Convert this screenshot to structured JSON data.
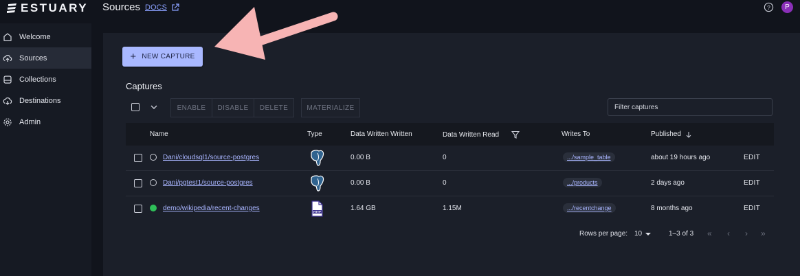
{
  "app": {
    "logo_text": "ESTUARY",
    "page_title": "Sources",
    "docs_label": "DOCS",
    "avatar_letter": "P"
  },
  "sidebar": {
    "items": [
      {
        "label": "Welcome",
        "icon": "home-icon",
        "active": false
      },
      {
        "label": "Sources",
        "icon": "cloud-upload-icon",
        "active": true
      },
      {
        "label": "Collections",
        "icon": "database-icon",
        "active": false
      },
      {
        "label": "Destinations",
        "icon": "cloud-download-icon",
        "active": false
      },
      {
        "label": "Admin",
        "icon": "gear-icon",
        "active": false
      }
    ]
  },
  "main": {
    "new_capture_label": "NEW CAPTURE",
    "captures_title": "Captures",
    "toolbar": {
      "enable": "ENABLE",
      "disable": "DISABLE",
      "delete": "DELETE",
      "materialize": "MATERIALIZE"
    },
    "filter_placeholder": "Filter captures"
  },
  "table": {
    "columns": [
      "Name",
      "Type",
      "Data Written Written",
      "Data Written Read",
      "Writes To",
      "Published"
    ],
    "rows": [
      {
        "name": "Dani/cloudsql1/source-postgres",
        "status": "inactive",
        "type_icon": "postgres-icon",
        "written": "0.00 B",
        "read": "0",
        "writes_to": ".../sample_table",
        "published": "about 19 hours ago",
        "action": "EDIT"
      },
      {
        "name": "Dani/pgtest1/source-postgres",
        "status": "inactive",
        "type_icon": "postgres-icon",
        "written": "0.00 B",
        "read": "0",
        "writes_to": ".../products",
        "published": "2 days ago",
        "action": "EDIT"
      },
      {
        "name": "demo/wikipedia/recent-changes",
        "status": "active",
        "type_icon": "http-file-icon",
        "written": "1.64 GB",
        "read": "1.15M",
        "writes_to": ".../recentchange",
        "published": "8 months ago",
        "action": "EDIT"
      }
    ],
    "footer": {
      "rows_per_page_label": "Rows per page:",
      "rows_per_page_value": "10",
      "range": "1–3 of 3"
    }
  },
  "colors": {
    "accent": "#a9b8ff",
    "status_active": "#2fbf59",
    "annotation_arrow": "#f7b4b4"
  }
}
